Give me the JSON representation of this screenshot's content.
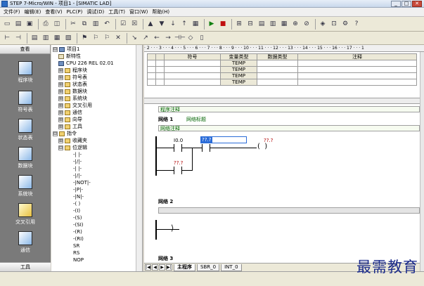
{
  "window": {
    "title": "STEP 7-Micro/WIN - 项目1 - [SIMATIC LAD]",
    "min": "_",
    "max": "□",
    "close": "✕"
  },
  "menu": [
    "文件(F)",
    "编辑(E)",
    "查看(V)",
    "PLC(P)",
    "调试(D)",
    "工具(T)",
    "窗口(W)",
    "帮助(H)"
  ],
  "left_pane": {
    "header": "查看",
    "items": [
      {
        "label": "程序块",
        "icon": "program-block-icon"
      },
      {
        "label": "符号表",
        "icon": "symbol-table-icon"
      },
      {
        "label": "状态表",
        "icon": "status-table-icon"
      },
      {
        "label": "数据块",
        "icon": "data-block-icon"
      },
      {
        "label": "系统块",
        "icon": "system-block-icon"
      },
      {
        "label": "交叉引用",
        "icon": "cross-ref-icon"
      },
      {
        "label": "通信",
        "icon": "communication-icon"
      }
    ],
    "footer": "工具"
  },
  "tree": [
    {
      "label": "项目1",
      "expander": "⊟",
      "icon": "project"
    },
    {
      "label": "新特性",
      "icon": "doc"
    },
    {
      "label": "CPU 226 REL 02.01",
      "icon": "cpu"
    },
    {
      "label": "程序块",
      "expander": "⊞",
      "icon": "folder"
    },
    {
      "label": "符号表",
      "expander": "⊞",
      "icon": "folder"
    },
    {
      "label": "状态表",
      "expander": "⊞",
      "icon": "folder"
    },
    {
      "label": "数据块",
      "expander": "⊞",
      "icon": "folder"
    },
    {
      "label": "系统块",
      "expander": "⊞",
      "icon": "folder"
    },
    {
      "label": "交叉引用",
      "expander": "⊞",
      "icon": "folder"
    },
    {
      "label": "通信",
      "expander": "⊞",
      "icon": "folder"
    },
    {
      "label": "向导",
      "expander": "⊞",
      "icon": "folder"
    },
    {
      "label": "工具",
      "expander": "⊞",
      "icon": "folder"
    },
    {
      "label": "指令",
      "expander": "⊟",
      "icon": "folder"
    },
    {
      "label": "收藏夹",
      "expander": "⊞",
      "icon": "folder"
    },
    {
      "label": "位逻辑",
      "expander": "⊟",
      "icon": "folder"
    },
    {
      "label": "-| |-",
      "icon": "contact"
    },
    {
      "label": "-|/|-",
      "icon": "contact"
    },
    {
      "label": "-| |-",
      "icon": "contact"
    },
    {
      "label": "-|/|-",
      "icon": "contact"
    },
    {
      "label": "-|NOT|-",
      "icon": "contact"
    },
    {
      "label": "-|P|-",
      "icon": "contact"
    },
    {
      "label": "-|N|-",
      "icon": "contact"
    },
    {
      "label": "-( )",
      "icon": "contact"
    },
    {
      "label": "-(I)",
      "icon": "contact"
    },
    {
      "label": "-(S)",
      "icon": "contact"
    },
    {
      "label": "-(SI)",
      "icon": "contact"
    },
    {
      "label": "-(R)",
      "icon": "contact"
    },
    {
      "label": "-(RI)",
      "icon": "contact"
    },
    {
      "label": "SR",
      "icon": "contact"
    },
    {
      "label": "RS",
      "icon": "contact"
    },
    {
      "label": "NOP",
      "icon": "contact"
    }
  ],
  "ruler": "· 2 · · · 3 · · · 4 · · · 5 · · · 6 · · · 7 · · · 8 · · · 9 · · · 10 · · · 11 · · · 12 · · · 13 · · · 14 · · · 15 · · · 16 · · · 17 · · · 1",
  "var_table": {
    "headers": [
      "",
      "",
      "符号",
      "变量类型",
      "数据类型",
      "注释"
    ],
    "rows": [
      [
        "",
        "",
        "",
        "TEMP",
        "",
        ""
      ],
      [
        "",
        "",
        "",
        "TEMP",
        "",
        ""
      ],
      [
        "",
        "",
        "",
        "TEMP",
        "",
        ""
      ],
      [
        "",
        "",
        "",
        "TEMP",
        "",
        ""
      ]
    ]
  },
  "ladder": {
    "program_comment": "程序注释",
    "network1": {
      "label": "网络 1",
      "title": "网络标题",
      "comment": "网络注释",
      "contact1_addr": "I0.0",
      "contact2_addr": "??.?",
      "coil_addr": "??.?",
      "branch_addr": "??.?"
    },
    "network2": {
      "label": "网络 2"
    },
    "network3": {
      "label": "网络 3"
    }
  },
  "tabs": {
    "nav": [
      "|◀",
      "◀",
      "▶",
      "▶|"
    ],
    "items": [
      "主程序",
      "SBR_0",
      "INT_0"
    ]
  },
  "watermark": "最需教育"
}
